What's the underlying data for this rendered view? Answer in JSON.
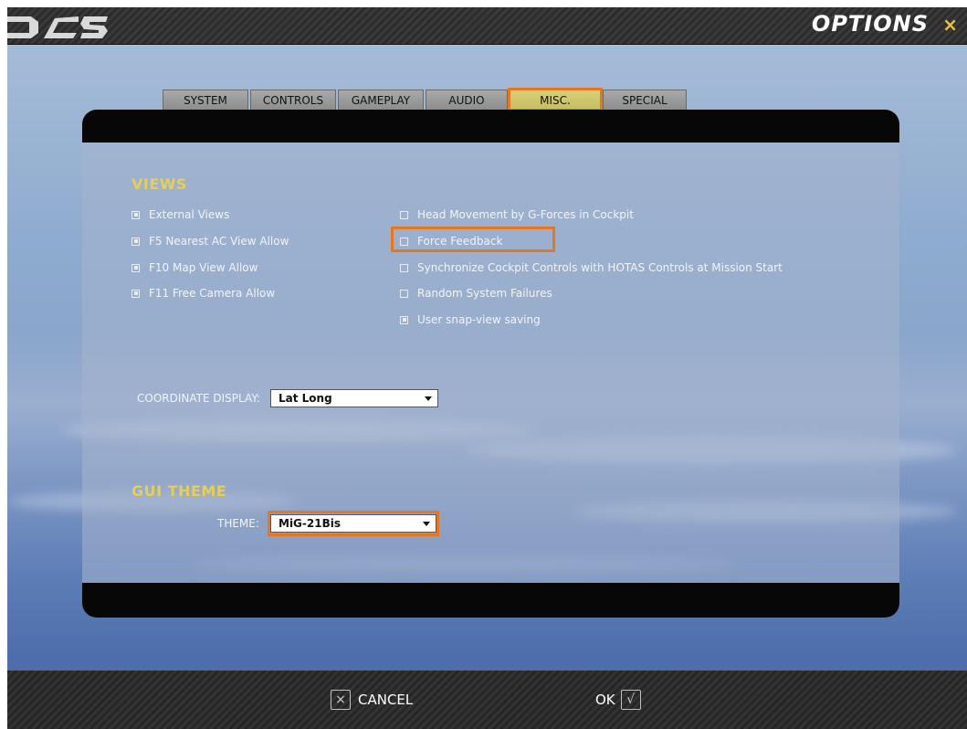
{
  "window": {
    "title": "OPTIONS",
    "close_glyph": "×",
    "logo": "DCS"
  },
  "tabs": [
    {
      "label": "SYSTEM",
      "active": false
    },
    {
      "label": "CONTROLS",
      "active": false
    },
    {
      "label": "GAMEPLAY",
      "active": false
    },
    {
      "label": "AUDIO",
      "active": false
    },
    {
      "label": "MISC.",
      "active": true
    },
    {
      "label": "SPECIAL",
      "active": false
    }
  ],
  "views": {
    "title": "VIEWS",
    "left_options": [
      {
        "label": "External Views",
        "checked": true
      },
      {
        "label": "F5 Nearest AC View Allow",
        "checked": true
      },
      {
        "label": "F10 Map View Allow",
        "checked": true
      },
      {
        "label": "F11 Free Camera Allow",
        "checked": true
      }
    ],
    "right_options": [
      {
        "label": "Head Movement by G-Forces in Cockpit",
        "checked": false
      },
      {
        "label": "Force Feedback",
        "checked": false
      },
      {
        "label": "Synchronize Cockpit Controls with HOTAS Controls at Mission Start",
        "checked": false
      },
      {
        "label": "Random System Failures",
        "checked": false
      },
      {
        "label": "User snap-view saving",
        "checked": true
      }
    ]
  },
  "coordinate": {
    "label": "COORDINATE DISPLAY:",
    "value": "Lat Long"
  },
  "gui_theme": {
    "title": "GUI THEME",
    "label": "THEME:",
    "value": "MiG-21Bis"
  },
  "footer": {
    "cancel_label": "CANCEL",
    "cancel_glyph": "×",
    "ok_label": "OK",
    "ok_glyph": "√"
  },
  "colors": {
    "accent": "#e8761d",
    "section": "#e6cf55",
    "active_tab": "#d0c86e"
  }
}
